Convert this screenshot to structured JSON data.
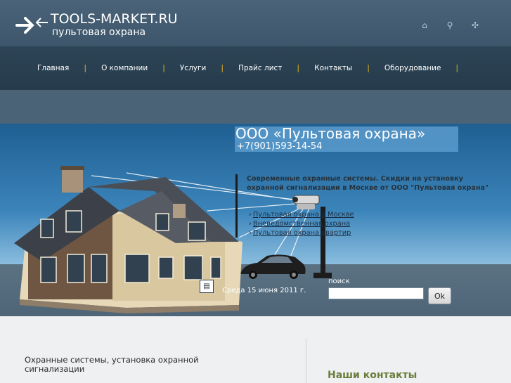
{
  "logo": {
    "title": "TOOLS-MARKET.RU",
    "subtitle": "пультовая охрана"
  },
  "header_icons": [
    "home-icon",
    "search-icon",
    "sitemap-icon"
  ],
  "nav": {
    "items": [
      {
        "label": "Главная"
      },
      {
        "label": "О компании"
      },
      {
        "label": "Услуги"
      },
      {
        "label": "Прайс лист"
      },
      {
        "label": "Контакты"
      },
      {
        "label": "Оборудование"
      }
    ],
    "separator": "|"
  },
  "hero": {
    "company_name": "ООО «Пультовая охрана»",
    "phone": "+7(901)593-14-54",
    "promo": "Современные охранные системы. Скидки на установку охранной сигнализации в Москве от ООО \"Пультовая охрана\"",
    "links": [
      {
        "label": "Пультовая охрана в Москве"
      },
      {
        "label": "Вневедомственная охрана"
      },
      {
        "label": "Пультовая охрана квартир"
      }
    ],
    "date": "Среда 15 июня 2011 г."
  },
  "search": {
    "label": "поиск",
    "value": "",
    "button": "Ok"
  },
  "content": {
    "title": "Охранные системы, установка охранной сигнализации",
    "contacts_title": "Наши контакты"
  },
  "colors": {
    "accent": "#e2b420",
    "contacts": "#6b7d3a"
  }
}
